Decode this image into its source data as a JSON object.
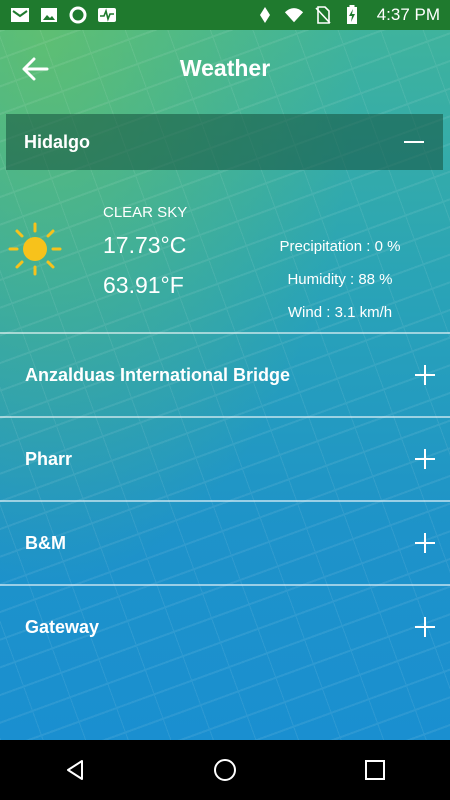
{
  "status_bar": {
    "time": "4:37 PM",
    "left_icons": [
      "mail-icon",
      "image-icon",
      "circle-icon",
      "activity-icon"
    ],
    "right_icons": [
      "vibrate-icon",
      "wifi-icon",
      "no-sim-icon",
      "battery-charging-icon"
    ]
  },
  "header": {
    "title": "Weather",
    "back_icon": "arrow-left-icon"
  },
  "locations": [
    {
      "name": "Hidalgo",
      "expanded": true,
      "weather": {
        "condition": "CLEAR SKY",
        "icon": "sun-icon",
        "temp_c": "17.73°C",
        "temp_f": "63.91°F",
        "precipitation": "Precipitation : 0 %",
        "humidity": "Humidity : 88 %",
        "wind": "Wind : 3.1 km/h"
      }
    },
    {
      "name": "Anzalduas International Bridge",
      "expanded": false
    },
    {
      "name": "Pharr",
      "expanded": false
    },
    {
      "name": "B&M",
      "expanded": false
    },
    {
      "name": "Gateway",
      "expanded": false
    }
  ],
  "nav_bar": {
    "buttons": [
      "back-triangle-icon",
      "home-circle-icon",
      "recents-square-icon"
    ]
  },
  "colors": {
    "status_bar": "#1f7a2e",
    "accent_gradient_top": "#3fb39d",
    "accent_gradient_bottom": "#1a8fd0",
    "sun": "#f7c21b"
  }
}
